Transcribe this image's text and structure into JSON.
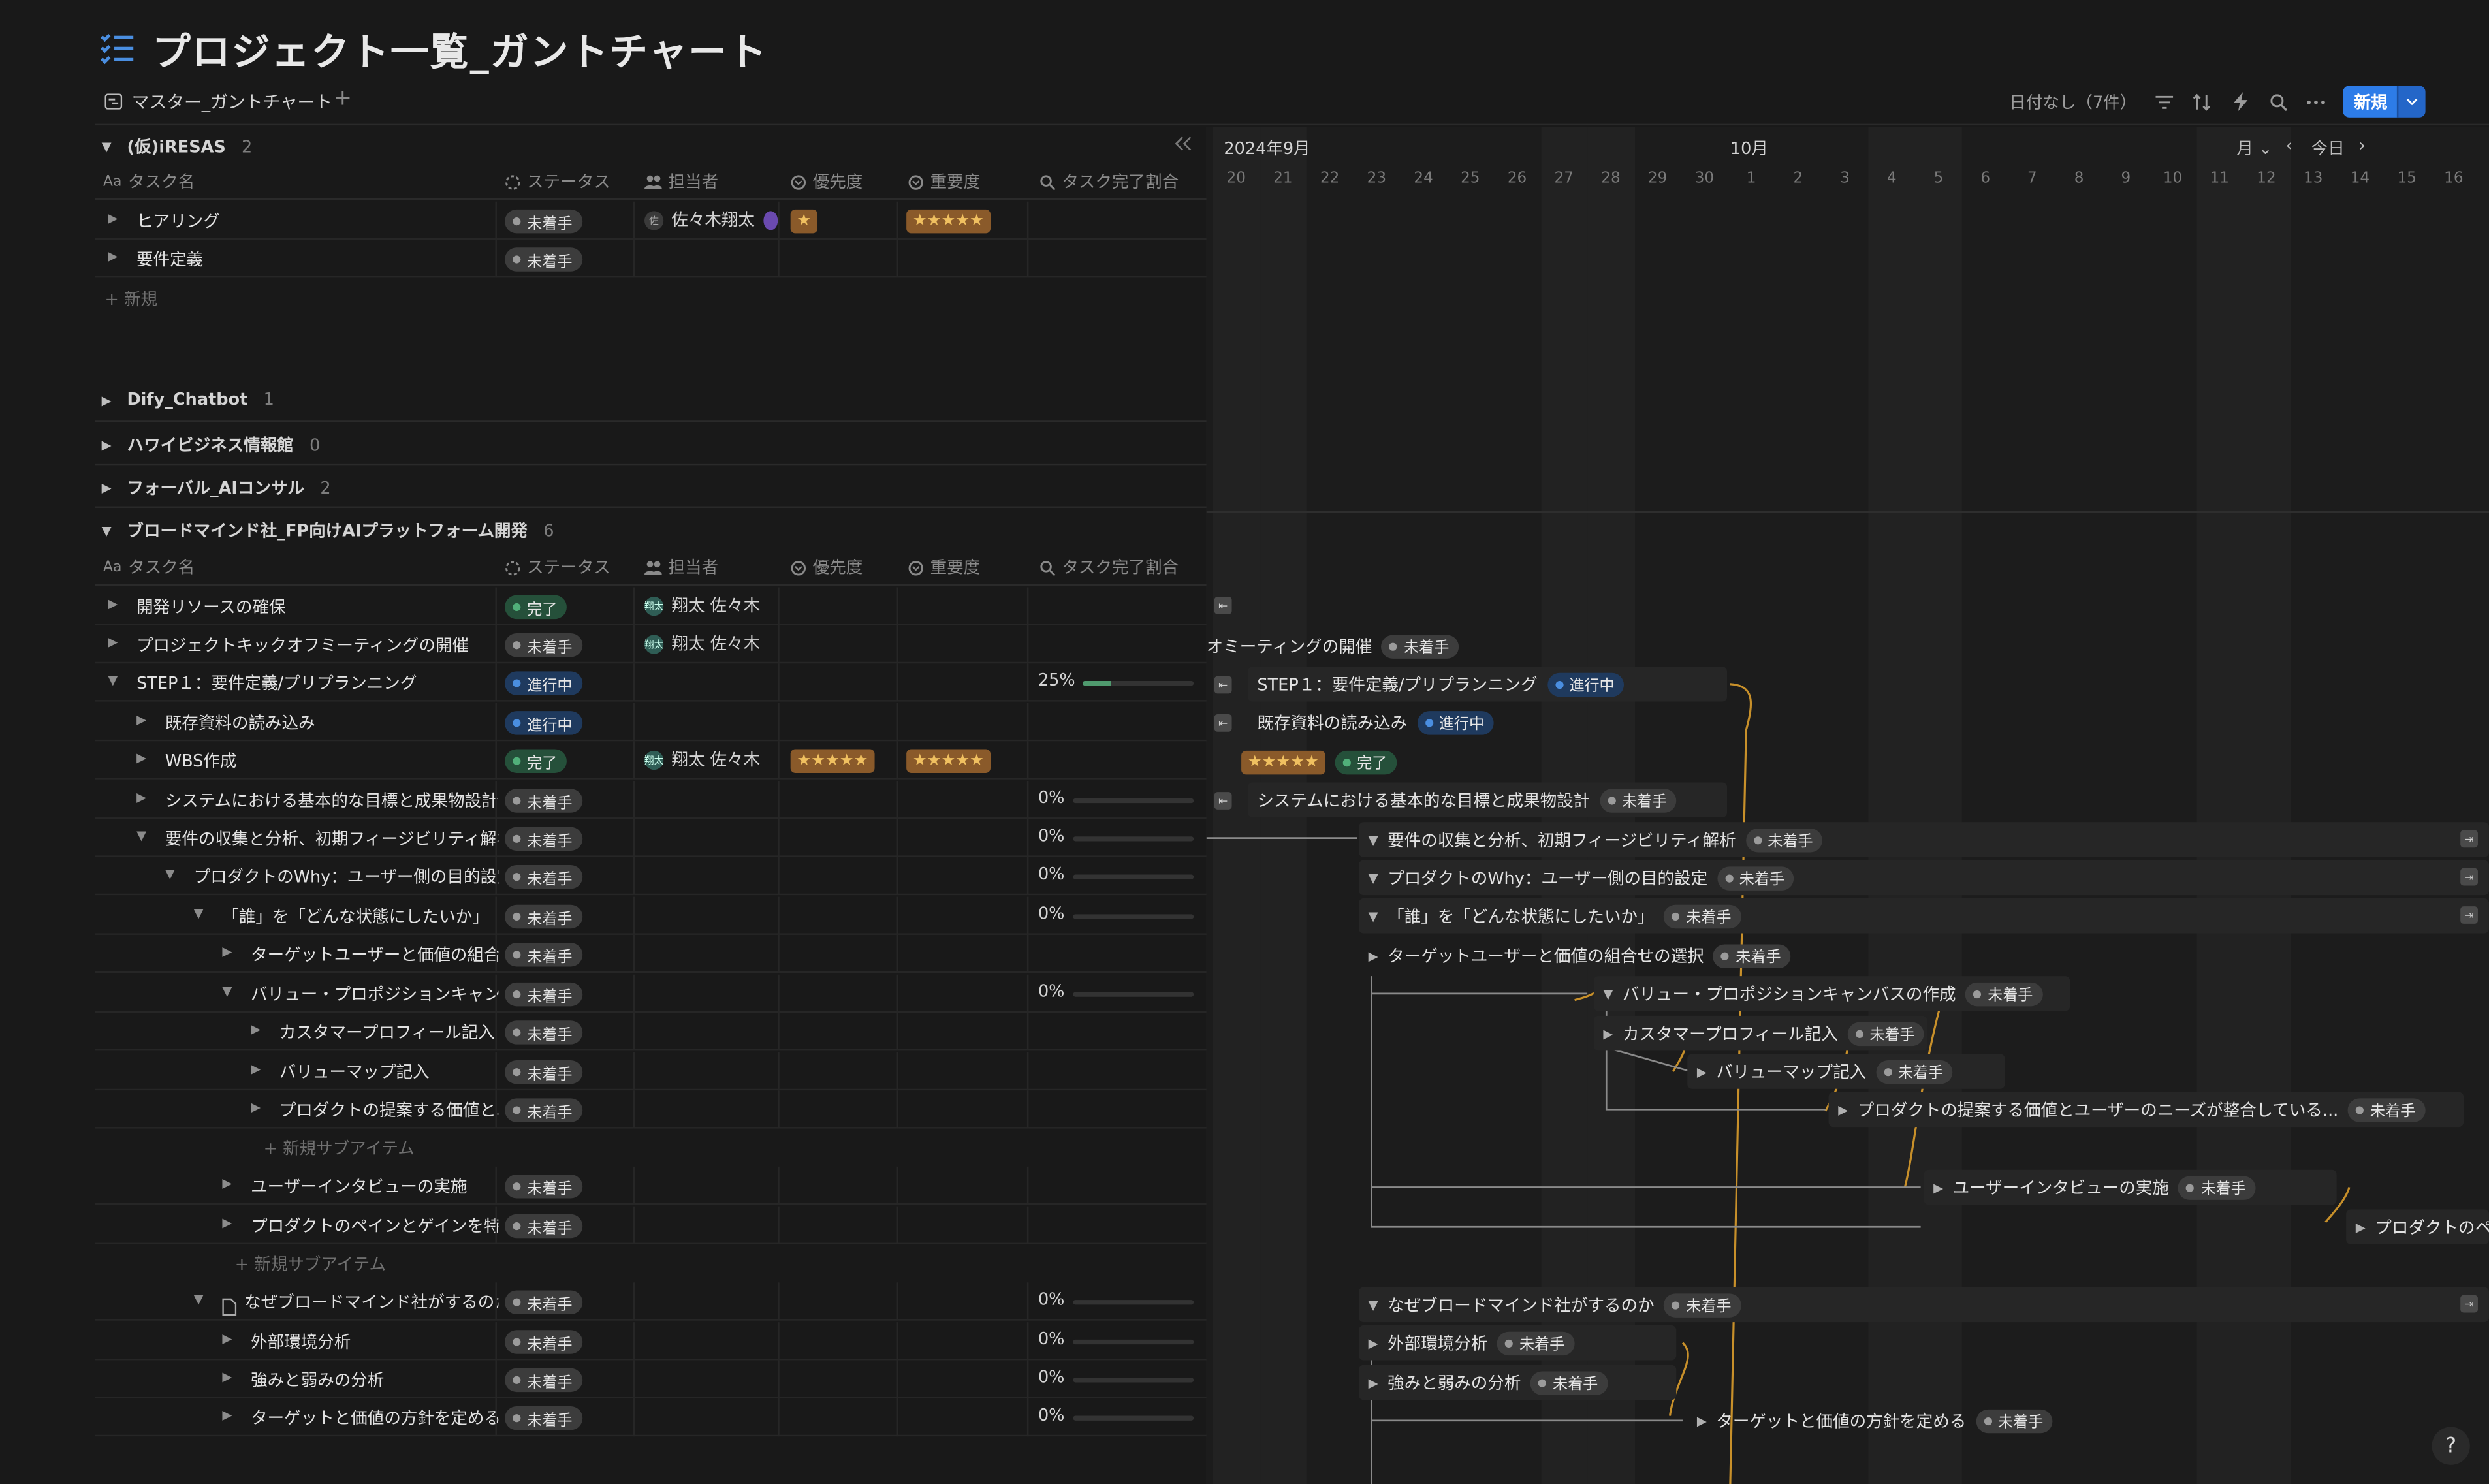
{
  "page": {
    "title": "プロジェクト一覧_ガントチャート",
    "view_tab": "マスター_ガントチャート",
    "add": "+"
  },
  "toolbar": {
    "no_date": "日付なし（7件）",
    "new_label": "新規"
  },
  "columns": {
    "name": "タスク名",
    "name_prefix": "Aa",
    "status": "ステータス",
    "assignee": "担当者",
    "priority": "優先度",
    "importance": "重要度",
    "completion": "タスク完了割合"
  },
  "groups": [
    {
      "name": "(仮)iRESAS",
      "count": "2"
    },
    {
      "name": "Dify_Chatbot",
      "count": "1"
    },
    {
      "name": "ハワイビジネス情報館",
      "count": "0"
    },
    {
      "name": "フォーバル_AIコンサル",
      "count": "2"
    },
    {
      "name": "ブロードマインド社_FP向けAIプラットフォーム開発",
      "count": "6"
    }
  ],
  "group1_rows": [
    {
      "name": "ヒアリング",
      "status": "未着手",
      "assignee": "佐々木翔太",
      "priority": "★",
      "importance": "★★★★★"
    },
    {
      "name": "要件定義",
      "status": "未着手"
    }
  ],
  "new_row": "新規",
  "new_subitem": "新規サブアイテム",
  "rows": [
    {
      "name": "開発リソースの確保",
      "status": "完了",
      "assignee": "翔太 佐々木"
    },
    {
      "name": "プロジェクトキックオフミーティングの開催",
      "status": "未着手",
      "assignee": "翔太 佐々木"
    },
    {
      "name": "STEP１：要件定義/プリプランニング",
      "status": "進行中",
      "pct": "25%"
    },
    {
      "name": "既存資料の読み込み",
      "status": "進行中"
    },
    {
      "name": "WBS作成",
      "status": "完了",
      "assignee": "翔太 佐々木",
      "priority": "★★★★★",
      "importance": "★★★★★"
    },
    {
      "name": "システムにおける基本的な目標と成果物設計",
      "status": "未着手",
      "pct": "0%"
    },
    {
      "name": "要件の収集と分析、初期フィージビリティ解析",
      "status": "未着手",
      "pct": "0%"
    },
    {
      "name": "プロダクトのWhy：ユーザー側の目的設定",
      "status": "未着手",
      "pct": "0%"
    },
    {
      "name": "「誰」を「どんな状態にしたいか」",
      "status": "未着手",
      "pct": "0%"
    },
    {
      "name": "ターゲットユーザーと価値の組合せの選択",
      "status": "未着手"
    },
    {
      "name": "バリュー・プロポジションキャンバスの作成",
      "status": "未着手",
      "pct": "0%"
    },
    {
      "name": "カスタマープロフィール記入",
      "status": "未着手"
    },
    {
      "name": "バリューマップ記入",
      "status": "未着手"
    },
    {
      "name": "プロダクトの提案する価値とユーザーのニーズが整合している...",
      "status": "未着手"
    },
    {
      "name": "ユーザーインタビューの実施",
      "status": "未着手"
    },
    {
      "name": "プロダクトのペインとゲインを特定する",
      "status": "未着手"
    },
    {
      "name": "なぜブロードマインド社がするのか",
      "status": "未着手",
      "pct": "0%"
    },
    {
      "name": "外部環境分析",
      "status": "未着手",
      "pct": "0%"
    },
    {
      "name": "強みと弱みの分析",
      "status": "未着手",
      "pct": "0%"
    },
    {
      "name": "ターゲットと価値の方針を定める",
      "status": "未着手",
      "pct": "0%"
    }
  ],
  "gantt": {
    "month1": "2024年9月",
    "month2": "10月",
    "scale": "月",
    "today": "今日",
    "days": [
      "20",
      "21",
      "22",
      "23",
      "24",
      "25",
      "26",
      "27",
      "28",
      "29",
      "30",
      "1",
      "2",
      "3",
      "4",
      "5",
      "6",
      "7",
      "8",
      "9",
      "10",
      "11",
      "12",
      "13",
      "14",
      "15",
      "16"
    ],
    "kickoff_partial": "オミーティングの開催",
    "step1": "STEP１：要件定義/プリプランニング",
    "existing": "既存資料の読み込み",
    "wbs_stars": "★★★★★",
    "system": "システムにおける基本的な目標と成果物設計",
    "req": "要件の収集と分析、初期フィージビリティ解析",
    "why": "プロダクトのWhy：ユーザー側の目的設定",
    "who": "「誰」を「どんな状態にしたいか」",
    "target": "ターゲットユーザーと価値の組合せの選択",
    "vpc": "バリュー・プロポジションキャンバスの作成",
    "customer": "カスタマープロフィール記入",
    "valuemap": "バリューマップ記入",
    "proposal": "プロダクトの提案する価値とユーザーのニーズが整合している...",
    "interview": "ユーザーインタビューの実施",
    "pain_partial": "プロダクトのペ",
    "whybm": "なぜブロードマインド社がするのか",
    "ext": "外部環境分析",
    "sw": "強みと弱みの分析",
    "tv": "ターゲットと価値の方針を定める"
  },
  "colors": {
    "accent": "#2d7ce8",
    "done": "#51b07a",
    "progress": "#4a8ee0",
    "stars": "#f0c060",
    "dependency": "#c8902a"
  }
}
